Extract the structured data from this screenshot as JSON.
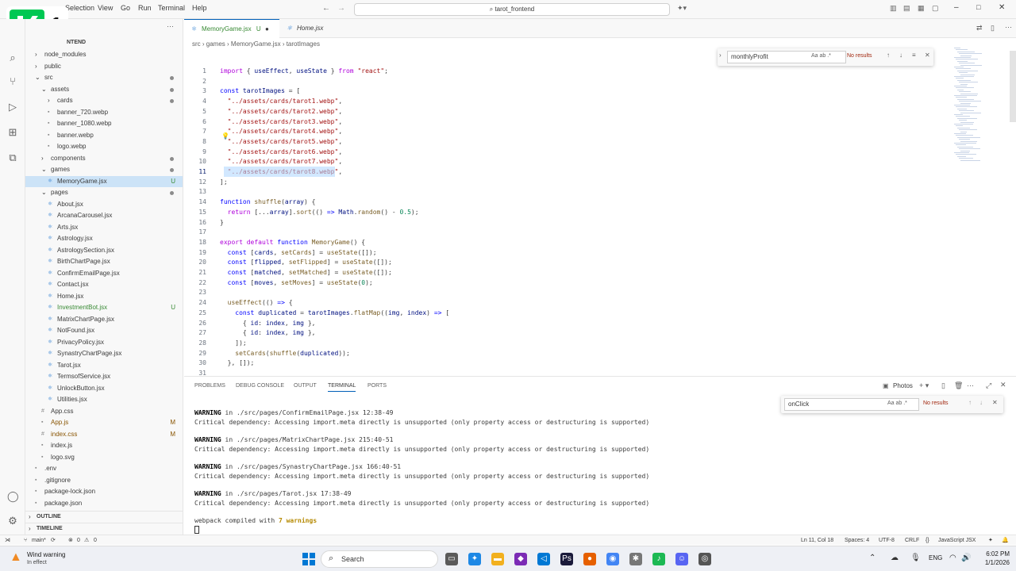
{
  "titlebar": {
    "menus": [
      "Selection",
      "View",
      "Go",
      "Run",
      "Terminal",
      "Help"
    ],
    "search": "tarot_frontend"
  },
  "logo": {
    "text": "1"
  },
  "sidebar": {
    "header": "NTEND",
    "items": [
      {
        "label": "node_modules",
        "indent": 1,
        "kind": "folder",
        "badge": ""
      },
      {
        "label": "public",
        "indent": 1,
        "kind": "folder",
        "badge": ""
      },
      {
        "label": "src",
        "indent": 1,
        "kind": "folder-open",
        "badge": "",
        "dot": true
      },
      {
        "label": "assets",
        "indent": 2,
        "kind": "folder-open",
        "badge": "",
        "dot": true
      },
      {
        "label": "cards",
        "indent": 3,
        "kind": "folder",
        "badge": "",
        "dot": true
      },
      {
        "label": "banner_720.webp",
        "indent": 3,
        "kind": "file",
        "badge": ""
      },
      {
        "label": "banner_1080.webp",
        "indent": 3,
        "kind": "file",
        "badge": ""
      },
      {
        "label": "banner.webp",
        "indent": 3,
        "kind": "file",
        "badge": ""
      },
      {
        "label": "logo.webp",
        "indent": 3,
        "kind": "file",
        "badge": ""
      },
      {
        "label": "components",
        "indent": 2,
        "kind": "folder",
        "badge": "",
        "dot": true
      },
      {
        "label": "games",
        "indent": 2,
        "kind": "folder-open",
        "badge": "",
        "dot": true
      },
      {
        "label": "MemoryGame.jsx",
        "indent": 3,
        "kind": "file",
        "badge": "U",
        "selected": true
      },
      {
        "label": "pages",
        "indent": 2,
        "kind": "folder-open",
        "badge": "",
        "dot": true
      },
      {
        "label": "About.jsx",
        "indent": 3,
        "kind": "file",
        "badge": ""
      },
      {
        "label": "ArcanaCarousel.jsx",
        "indent": 3,
        "kind": "file",
        "badge": ""
      },
      {
        "label": "Arts.jsx",
        "indent": 3,
        "kind": "file",
        "badge": ""
      },
      {
        "label": "Astrology.jsx",
        "indent": 3,
        "kind": "file",
        "badge": ""
      },
      {
        "label": "AstrologySection.jsx",
        "indent": 3,
        "kind": "file",
        "badge": ""
      },
      {
        "label": "BirthChartPage.jsx",
        "indent": 3,
        "kind": "file",
        "badge": ""
      },
      {
        "label": "ConfirmEmailPage.jsx",
        "indent": 3,
        "kind": "file",
        "badge": ""
      },
      {
        "label": "Contact.jsx",
        "indent": 3,
        "kind": "file",
        "badge": ""
      },
      {
        "label": "Home.jsx",
        "indent": 3,
        "kind": "file",
        "badge": ""
      },
      {
        "label": "InvestmentBot.jsx",
        "indent": 3,
        "kind": "file",
        "badge": "U",
        "green": true
      },
      {
        "label": "MatrixChartPage.jsx",
        "indent": 3,
        "kind": "file",
        "badge": ""
      },
      {
        "label": "NotFound.jsx",
        "indent": 3,
        "kind": "file",
        "badge": ""
      },
      {
        "label": "PrivacyPolicy.jsx",
        "indent": 3,
        "kind": "file",
        "badge": ""
      },
      {
        "label": "SynastryChartPage.jsx",
        "indent": 3,
        "kind": "file",
        "badge": ""
      },
      {
        "label": "Tarot.jsx",
        "indent": 3,
        "kind": "file",
        "badge": ""
      },
      {
        "label": "TermsofService.jsx",
        "indent": 3,
        "kind": "file",
        "badge": ""
      },
      {
        "label": "UnlockButton.jsx",
        "indent": 3,
        "kind": "file",
        "badge": ""
      },
      {
        "label": "Utilities.jsx",
        "indent": 3,
        "kind": "file",
        "badge": ""
      },
      {
        "label": "App.css",
        "indent": 2,
        "kind": "file",
        "badge": ""
      },
      {
        "label": "App.js",
        "indent": 2,
        "kind": "file",
        "badge": "M",
        "mod": true
      },
      {
        "label": "index.css",
        "indent": 2,
        "kind": "file",
        "badge": "M",
        "mod": true
      },
      {
        "label": "index.js",
        "indent": 2,
        "kind": "file",
        "badge": ""
      },
      {
        "label": "logo.svg",
        "indent": 2,
        "kind": "file",
        "badge": ""
      },
      {
        "label": ".env",
        "indent": 1,
        "kind": "file",
        "badge": ""
      },
      {
        "label": ".gitignore",
        "indent": 1,
        "kind": "file",
        "badge": ""
      },
      {
        "label": "package-lock.json",
        "indent": 1,
        "kind": "file",
        "badge": ""
      },
      {
        "label": "package.json",
        "indent": 1,
        "kind": "file",
        "badge": ""
      }
    ],
    "outline": "OUTLINE",
    "timeline": "TIMELINE"
  },
  "tabs": [
    {
      "label": "MemoryGame.jsx",
      "suffix": "U",
      "active": true
    },
    {
      "label": "Home.jsx",
      "suffix": "",
      "active": false
    }
  ],
  "breadcrumb": [
    "src",
    "games",
    "MemoryGame.jsx",
    "tarotImages"
  ],
  "find_editor": {
    "value": "monthlyProfit",
    "result": "No results"
  },
  "code": [
    "<span class='kk'>import</span> { <span class='v'>useEffect</span>, <span class='v'>useState</span> } <span class='kk'>from</span> <span class='s'>\"react\"</span>;",
    "",
    "<span class='k'>const</span> <span class='v'>tarotImages</span> = [",
    "  <span class='s'>\"../assets/cards/tarot1.webp\"</span>,",
    "  <span class='s'>\"../assets/cards/tarot2.webp\"</span>,",
    "  <span class='s'>\"../assets/cards/tarot3.webp\"</span>,",
    "  <span class='s'>\"../assets/cards/tarot4.webp\"</span>,",
    "  <span class='s'>\"../assets/cards/tarot5.webp\"</span>,",
    "  <span class='s'>\"../assets/cards/tarot6.webp\"</span>,",
    "  <span class='s'>\"../assets/cards/tarot7.webp\"</span>,",
    "  <span class='s'>\"../assets/cards/tarot8.webp\"</span>,",
    "];",
    "",
    "<span class='k'>function</span> <span class='f'>shuffle</span>(<span class='v'>array</span>) {",
    "  <span class='kk'>return</span> [...<span class='v'>array</span>].<span class='f'>sort</span>(() <span class='k'>=&gt;</span> <span class='v'>Math</span>.<span class='f'>random</span>() - <span class='n'>0.5</span>);",
    "}",
    "",
    "<span class='kk'>export</span> <span class='kk'>default</span> <span class='k'>function</span> <span class='f'>MemoryGame</span>() {",
    "  <span class='k'>const</span> [<span class='v'>cards</span>, <span class='f'>setCards</span>] = <span class='f'>useState</span>([]);",
    "  <span class='k'>const</span> [<span class='v'>flipped</span>, <span class='f'>setFlipped</span>] = <span class='f'>useState</span>([]);",
    "  <span class='k'>const</span> [<span class='v'>matched</span>, <span class='f'>setMatched</span>] = <span class='f'>useState</span>([]);",
    "  <span class='k'>const</span> [<span class='v'>moves</span>, <span class='f'>setMoves</span>] = <span class='f'>useState</span>(<span class='n'>0</span>);",
    "",
    "  <span class='f'>useEffect</span>(() <span class='k'>=&gt;</span> {",
    "    <span class='k'>const</span> <span class='v'>duplicated</span> = <span class='v'>tarotImages</span>.<span class='f'>flatMap</span>((<span class='v'>img</span>, <span class='v'>index</span>) <span class='k'>=&gt;</span> [",
    "      { <span class='v'>id</span>: <span class='v'>index</span>, <span class='v'>img</span> },",
    "      { <span class='v'>id</span>: <span class='v'>index</span>, <span class='v'>img</span> },",
    "    ]);",
    "    <span class='f'>setCards</span>(<span class='f'>shuffle</span>(<span class='v'>duplicated</span>));",
    "  }, []);",
    ""
  ],
  "panel": {
    "tabs": [
      "PROBLEMS",
      "DEBUG CONSOLE",
      "OUTPUT",
      "TERMINAL",
      "PORTS"
    ],
    "active_tab": "TERMINAL",
    "terminal_name": "Photos",
    "find": {
      "value": "onClick",
      "result": "No results"
    },
    "lines": [
      {
        "warn": "WARNING",
        "rest": " in ./src/pages/ConfirmEmailPage.jsx 12:38-49"
      },
      {
        "text": "Critical dependency: Accessing import.meta directly is unsupported (only property access or destructuring is supported)"
      },
      {
        "warn": "WARNING",
        "rest": " in ./src/pages/MatrixChartPage.jsx 215:40-51"
      },
      {
        "text": "Critical dependency: Accessing import.meta directly is unsupported (only property access or destructuring is supported)"
      },
      {
        "warn": "WARNING",
        "rest": " in ./src/pages/SynastryChartPage.jsx 166:40-51"
      },
      {
        "text": "Critical dependency: Accessing import.meta directly is unsupported (only property access or destructuring is supported)"
      },
      {
        "warn": "WARNING",
        "rest": " in ./src/pages/Tarot.jsx 17:38-49"
      },
      {
        "text": "Critical dependency: Accessing import.meta directly is unsupported (only property access or destructuring is supported)"
      }
    ],
    "compiled_prefix": "webpack compiled with ",
    "compiled_warnings": "7 warnings"
  },
  "statusbar": {
    "branch": "main*",
    "errors": "0",
    "warnings": "0",
    "position": "Ln 11, Col 18",
    "spaces": "Spaces: 4",
    "encoding": "UTF-8",
    "eol": "CRLF",
    "language": "JavaScript JSX"
  },
  "taskbar": {
    "weather_title": "Wind warning",
    "weather_sub": "In effect",
    "search": "Search",
    "lang": "ENG",
    "time": "6:02 PM",
    "date": "1/1/2026"
  }
}
